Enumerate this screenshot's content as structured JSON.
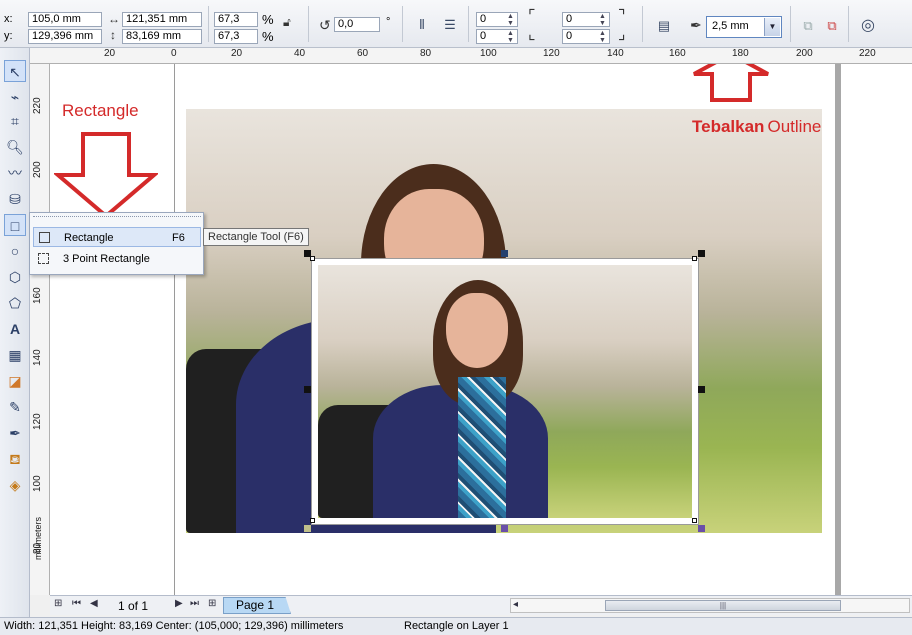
{
  "propbar": {
    "x_label": "x:",
    "x_value": "105,0 mm",
    "y_label": "y:",
    "y_value": "129,396 mm",
    "width_value": "121,351 mm",
    "height_value": "83,169 mm",
    "scale_x": "67,3",
    "scale_y": "67,3",
    "percent": "%",
    "rotation_value": "0,0",
    "degree": "°",
    "corner_tl": "0",
    "corner_bl": "0",
    "corner_tr": "0",
    "corner_br": "0",
    "outline_width": "2,5 mm"
  },
  "hruler": {
    "ticks": [
      "20",
      "0",
      "20",
      "40",
      "60",
      "80",
      "100",
      "120",
      "140",
      "160",
      "180",
      "200",
      "220"
    ]
  },
  "vruler": {
    "ticks": [
      "220",
      "200",
      "180",
      "160",
      "140",
      "120",
      "100",
      "80"
    ],
    "units": "millimeters"
  },
  "annotations": {
    "rectangle_label": "Rectangle",
    "outline_bold": "Tebalkan",
    "outline_word": "Outline"
  },
  "flyout": {
    "items": [
      {
        "label": "Rectangle",
        "shortcut": "F6"
      },
      {
        "label": "3 Point Rectangle",
        "shortcut": ""
      }
    ]
  },
  "tooltip": "Rectangle Tool (F6)",
  "bottombar": {
    "page_of": "1 of 1",
    "page_tab": "Page 1"
  },
  "statusbar": {
    "dimensions": "Width: 121,351  Height: 83,169  Center: (105,000; 129,396)  millimeters",
    "object_info": "Rectangle on Layer 1"
  },
  "colors": {
    "annotation_red": "#d42a2a",
    "selected_tab": "#b8d8f4"
  }
}
